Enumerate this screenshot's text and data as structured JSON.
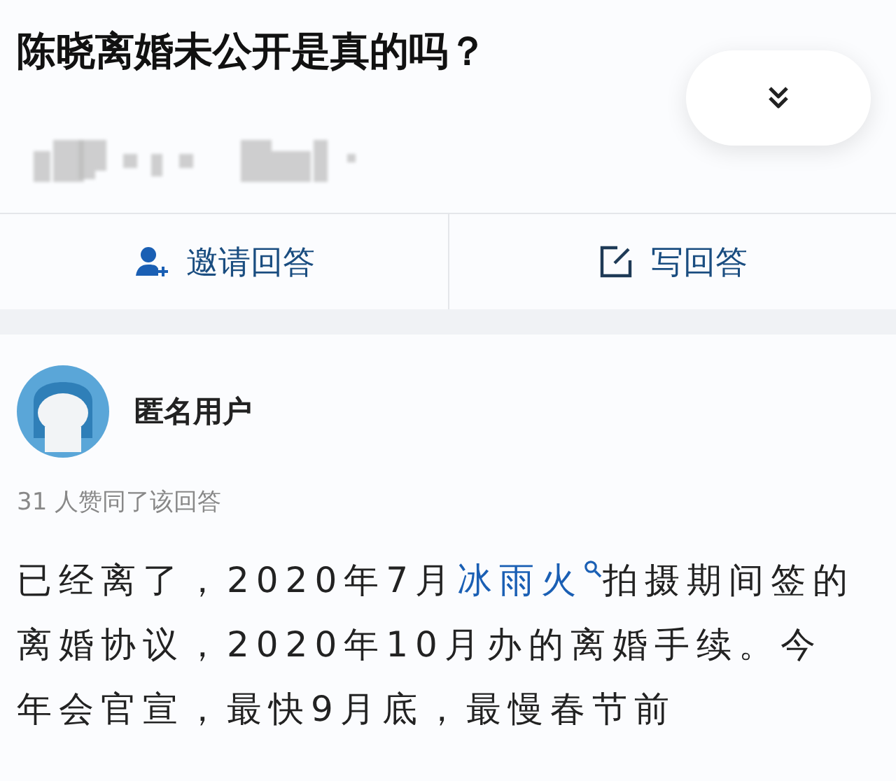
{
  "question": {
    "title": "陈晓离婚未公开是真的吗？"
  },
  "actions": [
    {
      "kind": "invite",
      "label": "邀请回答"
    },
    {
      "kind": "write",
      "label": "写回答"
    }
  ],
  "answer": {
    "author": "匿名用户",
    "votes": "31 人赞同了该回答",
    "body": [
      {
        "kind": "text",
        "text": "已经离了，2020年7月"
      },
      {
        "kind": "link",
        "text": "冰雨火"
      },
      {
        "kind": "text",
        "text": "拍摄期间签的离婚协议，2020年10月办的离婚手续。今年会官宣，最快9月底，最慢春节前"
      }
    ]
  }
}
